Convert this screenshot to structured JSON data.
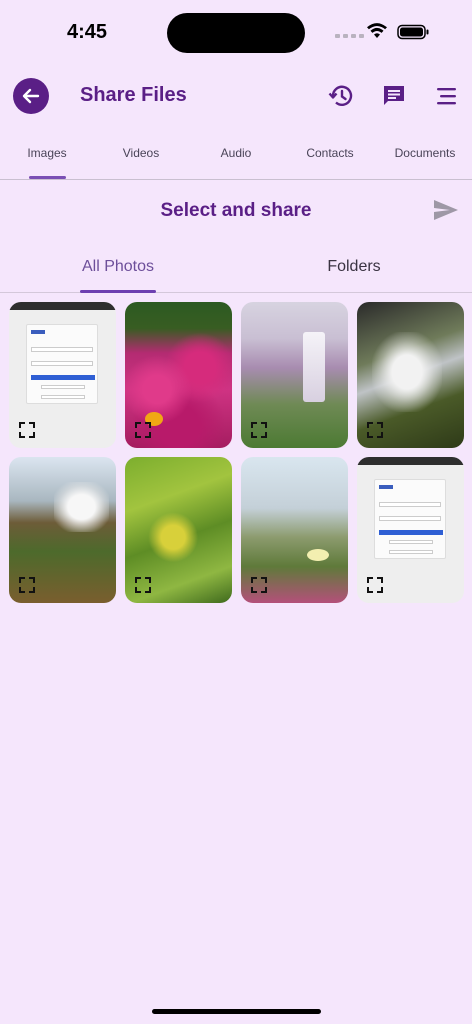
{
  "status_bar": {
    "time": "4:45"
  },
  "app_bar": {
    "title": "Share Files",
    "icons": [
      "arrow-left-icon",
      "history-icon",
      "message-icon",
      "menu-icon"
    ]
  },
  "category_tabs": [
    {
      "label": "Images",
      "selected": true
    },
    {
      "label": "Videos",
      "selected": false
    },
    {
      "label": "Audio",
      "selected": false
    },
    {
      "label": "Contacts",
      "selected": false
    },
    {
      "label": "Documents",
      "selected": false
    }
  ],
  "select_section": {
    "title": "Select and share",
    "icon": "send-icon"
  },
  "sub_tabs": [
    {
      "label": "All Photos",
      "selected": true
    },
    {
      "label": "Folders",
      "selected": false
    }
  ],
  "photos": [
    {
      "subject": "login screenshot"
    },
    {
      "subject": "pink flowers"
    },
    {
      "subject": "misty waterfall"
    },
    {
      "subject": "rocky waterfall"
    },
    {
      "subject": "waterfall at cliff"
    },
    {
      "subject": "green leaves"
    },
    {
      "subject": "white flower field"
    },
    {
      "subject": "login screenshot"
    }
  ],
  "colors": {
    "background": "#f5e6fc",
    "accent": "#5a1f86",
    "tab_indicator": "#6d3fb0"
  }
}
